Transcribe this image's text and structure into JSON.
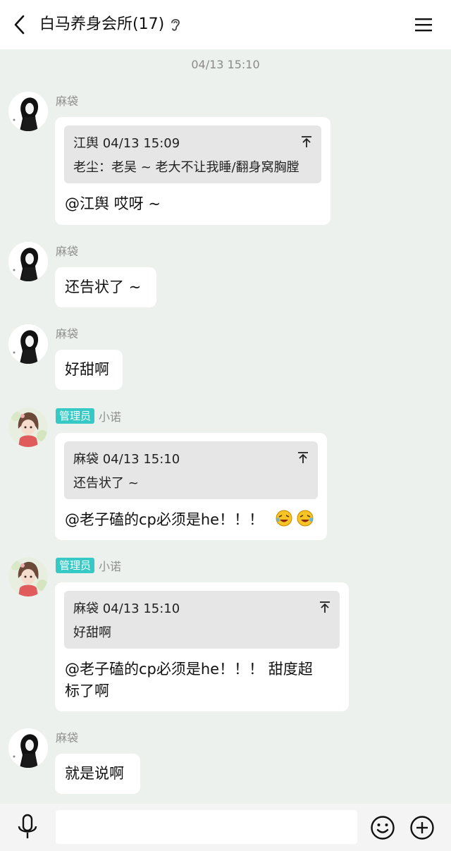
{
  "header": {
    "title": "白马养身会所(17)",
    "back_icon": "chevron-left-icon",
    "ear_icon": "ear-icon",
    "menu_icon": "hamburger-menu-icon"
  },
  "chat": {
    "timestamp": "04/13 15:10",
    "admin_badge": "管理员",
    "messages": [
      {
        "sender": "麻袋",
        "quote_meta": "江舆 04/13 15:09",
        "quote_text": "老尘：老吴 ~ 老大不让我睡/翻身窝胸膛",
        "text": "@江舆 哎呀 ~"
      },
      {
        "sender": "麻袋",
        "text": "还告状了 ~"
      },
      {
        "sender": "麻袋",
        "text": "好甜啊"
      },
      {
        "sender": "小诺",
        "is_admin": true,
        "quote_meta": "麻袋 04/13 15:10",
        "quote_text": "还告状了 ~",
        "text": "@老子磕的cp必须是he！！！",
        "emoji": "laughing-tears-emoji"
      },
      {
        "sender": "小诺",
        "is_admin": true,
        "quote_meta": "麻袋 04/13 15:10",
        "quote_text": "好甜啊",
        "text_line1": "@老子磕的cp必须是he！！！ 甜度超",
        "text_line2": "标了啊"
      },
      {
        "sender": "麻袋",
        "text": "就是说啊"
      }
    ]
  },
  "input_bar": {
    "mic_icon": "microphone-icon",
    "input_value": "",
    "emoji_icon": "smiley-icon",
    "plus_icon": "plus-circle-icon"
  },
  "colors": {
    "background": "#ecf1ed",
    "bubble": "#ffffff",
    "quote": "#e6e6e6",
    "admin_badge": "#36c9c6"
  }
}
